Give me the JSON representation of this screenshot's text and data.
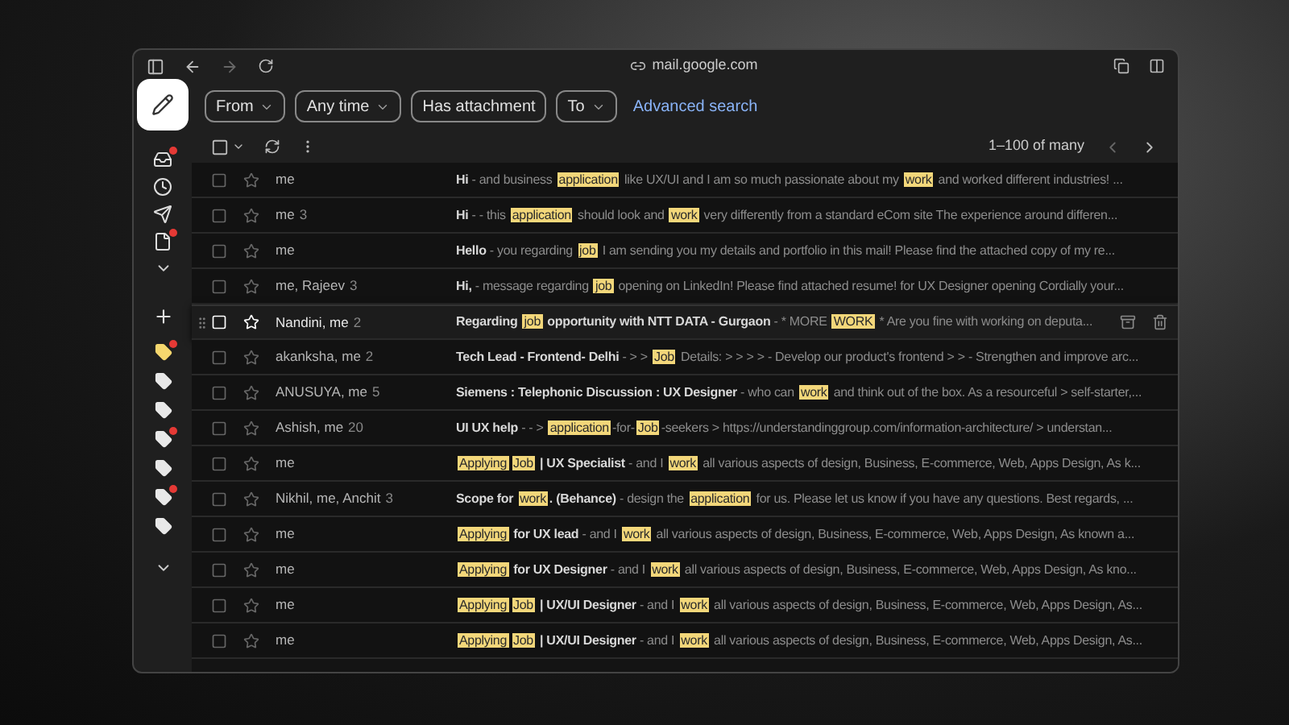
{
  "browser": {
    "url": "mail.google.com"
  },
  "rail": {
    "mail_items": [
      {
        "dot": true,
        "kind": "inbox"
      },
      {
        "dot": false,
        "kind": "snoozed"
      },
      {
        "dot": false,
        "kind": "sent"
      },
      {
        "dot": true,
        "kind": "drafts"
      }
    ],
    "labels": [
      {
        "color": "#f5d76e",
        "dot": true
      },
      {
        "color": "#e8e8e8",
        "dot": false
      },
      {
        "color": "#e8e8e8",
        "dot": false
      },
      {
        "color": "#e8e8e8",
        "dot": true
      },
      {
        "color": "#e8e8e8",
        "dot": false
      },
      {
        "color": "#e8e8e8",
        "dot": true
      },
      {
        "color": "#e8e8e8",
        "dot": false
      }
    ]
  },
  "filters": [
    "From",
    "Any time",
    "Has attachment",
    "To"
  ],
  "advanced_search": "Advanced search",
  "pagination": "1–100 of many",
  "select_all": {
    "checked": false
  },
  "rows": [
    {
      "sender": "me",
      "count": "",
      "hovered": false,
      "message": [
        {
          "kind": "subject",
          "text": "Hi"
        },
        {
          "kind": "snippet",
          "text": " - and business "
        },
        {
          "kind": "hit",
          "text": "application"
        },
        {
          "kind": "snippet",
          "text": " like UX/UI and I am so much passionate about my "
        },
        {
          "kind": "hit",
          "text": "work"
        },
        {
          "kind": "snippet",
          "text": " and worked different industries! ..."
        }
      ]
    },
    {
      "sender": "me",
      "count": "3",
      "hovered": false,
      "message": [
        {
          "kind": "subject",
          "text": "Hi"
        },
        {
          "kind": "snippet",
          "text": " - - this "
        },
        {
          "kind": "hit",
          "text": "application"
        },
        {
          "kind": "snippet",
          "text": " should look and "
        },
        {
          "kind": "hit",
          "text": "work"
        },
        {
          "kind": "snippet",
          "text": " very differently from a standard eCom site The experience around differen..."
        }
      ]
    },
    {
      "sender": "me",
      "count": "",
      "hovered": false,
      "message": [
        {
          "kind": "subject",
          "text": "Hello"
        },
        {
          "kind": "snippet",
          "text": " - you regarding "
        },
        {
          "kind": "hit",
          "text": "job"
        },
        {
          "kind": "snippet",
          "text": " I am sending you my details and portfolio in this mail! Please find the attached copy of my re..."
        }
      ]
    },
    {
      "sender": "me, Rajeev",
      "count": "3",
      "hovered": false,
      "message": [
        {
          "kind": "subject",
          "text": "Hi,"
        },
        {
          "kind": "snippet",
          "text": " - message regarding "
        },
        {
          "kind": "hit",
          "text": "job"
        },
        {
          "kind": "snippet",
          "text": " opening on LinkedIn! Please find attached resume! for UX Designer opening Cordially your..."
        }
      ]
    },
    {
      "sender": "Nandini, me",
      "count": "2",
      "hovered": true,
      "message": [
        {
          "kind": "subject",
          "text": "Regarding "
        },
        {
          "kind": "hit",
          "text": "job"
        },
        {
          "kind": "subject",
          "text": " opportunity with NTT DATA - Gurgaon"
        },
        {
          "kind": "snippet",
          "text": " - * MORE "
        },
        {
          "kind": "hit",
          "text": "WORK"
        },
        {
          "kind": "snippet",
          "text": " * Are you fine with working on deputa..."
        }
      ]
    },
    {
      "sender": "akanksha, me",
      "count": "2",
      "hovered": false,
      "message": [
        {
          "kind": "subject",
          "text": "Tech Lead - Frontend- Delhi"
        },
        {
          "kind": "snippet",
          "text": " - > > "
        },
        {
          "kind": "hit",
          "text": "Job"
        },
        {
          "kind": "snippet",
          "text": " Details: > > > > - Develop our product's frontend > > - Strengthen and improve arc..."
        }
      ]
    },
    {
      "sender": "ANUSUYA, me",
      "count": "5",
      "hovered": false,
      "message": [
        {
          "kind": "subject",
          "text": "Siemens : Telephonic Discussion : UX Designer"
        },
        {
          "kind": "snippet",
          "text": " - who can "
        },
        {
          "kind": "hit",
          "text": "work"
        },
        {
          "kind": "snippet",
          "text": " and think out of the box. As a resourceful > self-starter,..."
        }
      ]
    },
    {
      "sender": "Ashish, me",
      "count": "20",
      "hovered": false,
      "message": [
        {
          "kind": "subject",
          "text": "UI UX help"
        },
        {
          "kind": "snippet",
          "text": " - - > "
        },
        {
          "kind": "hit",
          "text": "application"
        },
        {
          "kind": "snippet",
          "text": "-for-"
        },
        {
          "kind": "hit",
          "text": "Job"
        },
        {
          "kind": "snippet",
          "text": "-seekers > https://understandinggroup.com/information-architecture/ > understan..."
        }
      ]
    },
    {
      "sender": "me",
      "count": "",
      "hovered": false,
      "message": [
        {
          "kind": "hit",
          "text": "Applying"
        },
        {
          "kind": "hit",
          "text": "Job"
        },
        {
          "kind": "subject",
          "text": " | UX Specialist"
        },
        {
          "kind": "snippet",
          "text": " - and I "
        },
        {
          "kind": "hit",
          "text": "work"
        },
        {
          "kind": "snippet",
          "text": " all various aspects of design, Business, E-commerce, Web, Apps Design, As k..."
        }
      ]
    },
    {
      "sender": "Nikhil, me, Anchit",
      "count": "3",
      "hovered": false,
      "message": [
        {
          "kind": "subject",
          "text": "Scope for "
        },
        {
          "kind": "hit",
          "text": "work"
        },
        {
          "kind": "subject",
          "text": ". (Behance)"
        },
        {
          "kind": "snippet",
          "text": " - design the "
        },
        {
          "kind": "hit",
          "text": "application"
        },
        {
          "kind": "snippet",
          "text": " for us. Please let us know if you have any questions. Best regards, ..."
        }
      ]
    },
    {
      "sender": "me",
      "count": "",
      "hovered": false,
      "message": [
        {
          "kind": "hit",
          "text": "Applying"
        },
        {
          "kind": "subject",
          "text": " for UX lead"
        },
        {
          "kind": "snippet",
          "text": " - and I "
        },
        {
          "kind": "hit",
          "text": "work"
        },
        {
          "kind": "snippet",
          "text": " all various aspects of design, Business, E-commerce, Web, Apps Design, As known a..."
        }
      ]
    },
    {
      "sender": "me",
      "count": "",
      "hovered": false,
      "message": [
        {
          "kind": "hit",
          "text": "Applying"
        },
        {
          "kind": "subject",
          "text": " for UX Designer"
        },
        {
          "kind": "snippet",
          "text": " - and I "
        },
        {
          "kind": "hit",
          "text": "work"
        },
        {
          "kind": "snippet",
          "text": " all various aspects of design, Business, E-commerce, Web, Apps Design, As kno..."
        }
      ]
    },
    {
      "sender": "me",
      "count": "",
      "hovered": false,
      "message": [
        {
          "kind": "hit",
          "text": "Applying"
        },
        {
          "kind": "hit",
          "text": "Job"
        },
        {
          "kind": "subject",
          "text": " | UX/UI Designer"
        },
        {
          "kind": "snippet",
          "text": " - and I "
        },
        {
          "kind": "hit",
          "text": "work"
        },
        {
          "kind": "snippet",
          "text": " all various aspects of design, Business, E-commerce, Web, Apps Design, As..."
        }
      ]
    },
    {
      "sender": "me",
      "count": "",
      "hovered": false,
      "message": [
        {
          "kind": "hit",
          "text": "Applying"
        },
        {
          "kind": "hit",
          "text": "Job"
        },
        {
          "kind": "subject",
          "text": " | UX/UI Designer"
        },
        {
          "kind": "snippet",
          "text": " - and I "
        },
        {
          "kind": "hit",
          "text": "work"
        },
        {
          "kind": "snippet",
          "text": " all various aspects of design, Business, E-commerce, Web, Apps Design, As..."
        }
      ]
    }
  ]
}
